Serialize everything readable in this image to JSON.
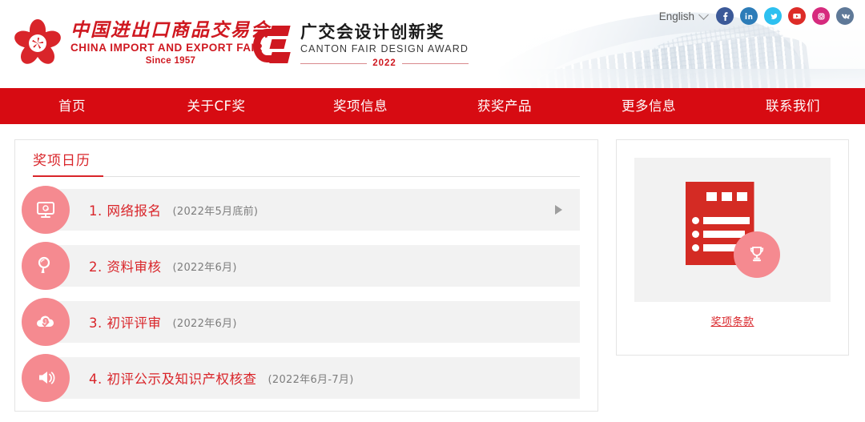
{
  "header": {
    "brand": {
      "logo_cn": "中国进出口商品交易会",
      "logo_en": "CHINA IMPORT AND EXPORT FAIR",
      "since": "Since 1957"
    },
    "award_brand": {
      "name_cn": "广交会设计创新奖",
      "name_en": "CANTON FAIR DESIGN AWARD",
      "year": "2022"
    },
    "language": {
      "label": "English"
    },
    "socials": [
      {
        "name": "facebook",
        "glyph": "f",
        "color": "#3b5998"
      },
      {
        "name": "linkedin",
        "glyph": "in",
        "color": "#2c7cb8"
      },
      {
        "name": "twitter",
        "glyph": "t",
        "color": "#2dc0f0"
      },
      {
        "name": "youtube",
        "glyph": "You",
        "color": "#dd2c28"
      },
      {
        "name": "instagram",
        "glyph": "o",
        "color": "#d62b7e"
      },
      {
        "name": "vk",
        "glyph": "vk",
        "color": "#5f7998"
      }
    ]
  },
  "nav": {
    "items": [
      {
        "label": "首页"
      },
      {
        "label": "关于CF奖"
      },
      {
        "label": "奖项信息"
      },
      {
        "label": "获奖产品"
      },
      {
        "label": "更多信息"
      },
      {
        "label": "联系我们"
      }
    ]
  },
  "main": {
    "tab": {
      "label": "奖项日历"
    },
    "calendar": [
      {
        "index": "1.",
        "label": "网络报名",
        "date": "(2022年5月底前)",
        "icon": "monitor-at-icon",
        "has_arrow": true
      },
      {
        "index": "2.",
        "label": "资料审核",
        "date": "(2022年6月)",
        "icon": "magnifier-icon",
        "has_arrow": false
      },
      {
        "index": "3.",
        "label": "初评评审",
        "date": "(2022年6月)",
        "icon": "cloud-check-icon",
        "has_arrow": false
      },
      {
        "index": "4.",
        "label": "初评公示及知识产权核查",
        "date": "(2022年6月-7月)",
        "icon": "megaphone-icon",
        "has_arrow": false
      }
    ]
  },
  "sidebar": {
    "promo": {
      "icon": "document-trophy-icon",
      "link_label": "奖项条款"
    }
  },
  "colors": {
    "brand_red": "#d70b12",
    "accent_red": "#d9252a",
    "icon_pink": "#f58a90",
    "row_grey": "#f2f2f2"
  }
}
